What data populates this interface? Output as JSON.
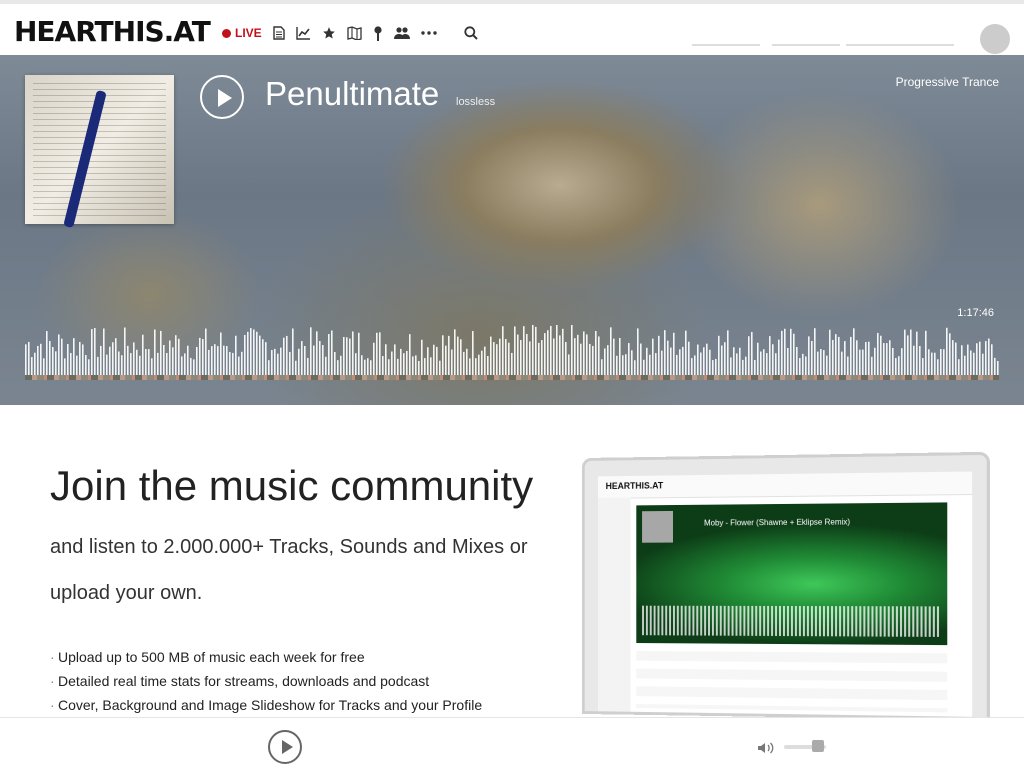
{
  "header": {
    "logo_text": "HEARTHIS.AT",
    "live_label": "LIVE",
    "nav_icons": [
      "document-icon",
      "chart-icon",
      "star-icon",
      "map-icon",
      "pin-icon",
      "group-icon",
      "more-icon"
    ],
    "search_icon": "search-icon"
  },
  "player": {
    "title": "Penultimate",
    "quality": "lossless",
    "genre": "Progressive Trance",
    "duration": "1:17:46"
  },
  "promo": {
    "heading": "Join the music community",
    "subheading": "and listen to 2.000.000+ Tracks, Sounds and Mixes or upload your own.",
    "benefits": [
      "Upload up to 500 MB of music each week for free",
      "Detailed real time stats for streams, downloads and podcast",
      "Cover, Background and Image Slideshow for Tracks and your Profile"
    ],
    "screenshot": {
      "logo_text": "HEARTHIS.AT",
      "track_text": "Moby - Flower (Shawne + Eklipse Remix)"
    }
  },
  "colors": {
    "live_red": "#c0121b",
    "hero_overlay": "#6b7785"
  }
}
